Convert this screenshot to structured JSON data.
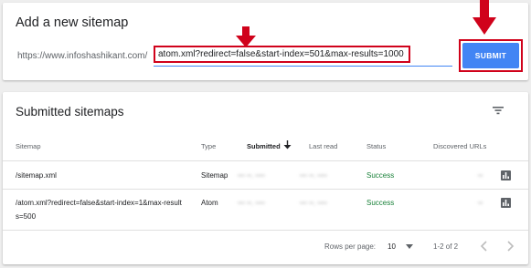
{
  "add_sitemap": {
    "title": "Add a new sitemap",
    "url_prefix": "https://www.infoshashikant.com/",
    "input_value": "atom.xml?redirect=false&start-index=501&max-results=1000",
    "submit_label": "SUBMIT"
  },
  "submitted": {
    "title": "Submitted sitemaps",
    "columns": {
      "sitemap": "Sitemap",
      "type": "Type",
      "submitted": "Submitted",
      "last_read": "Last read",
      "status": "Status",
      "discovered": "Discovered URLs"
    },
    "rows": [
      {
        "sitemap_line1": "/sitemap.xml",
        "sitemap_line2": "",
        "type": "Sitemap",
        "submitted": "••• ••, ••••",
        "last_read": "••• ••, ••••",
        "status": "Success",
        "discovered": "••"
      },
      {
        "sitemap_line1": "/atom.xml?redirect=false&start-index=1&max-result",
        "sitemap_line2": "s=500",
        "type": "Atom",
        "submitted": "••• ••, ••••",
        "last_read": "••• ••, ••••",
        "status": "Success",
        "discovered": "••"
      }
    ],
    "footer": {
      "rows_per_page_label": "Rows per page:",
      "rows_per_page_value": "10",
      "range": "1-2 of 2"
    }
  },
  "colors": {
    "accent": "#4285f4",
    "highlight": "#d0021b",
    "success": "#188038"
  },
  "icons": [
    "arrow-down-annotation",
    "filter-icon",
    "sort-arrow-down-icon",
    "bar-chart-icon",
    "dropdown-icon",
    "chevron-left-icon",
    "chevron-right-icon"
  ]
}
